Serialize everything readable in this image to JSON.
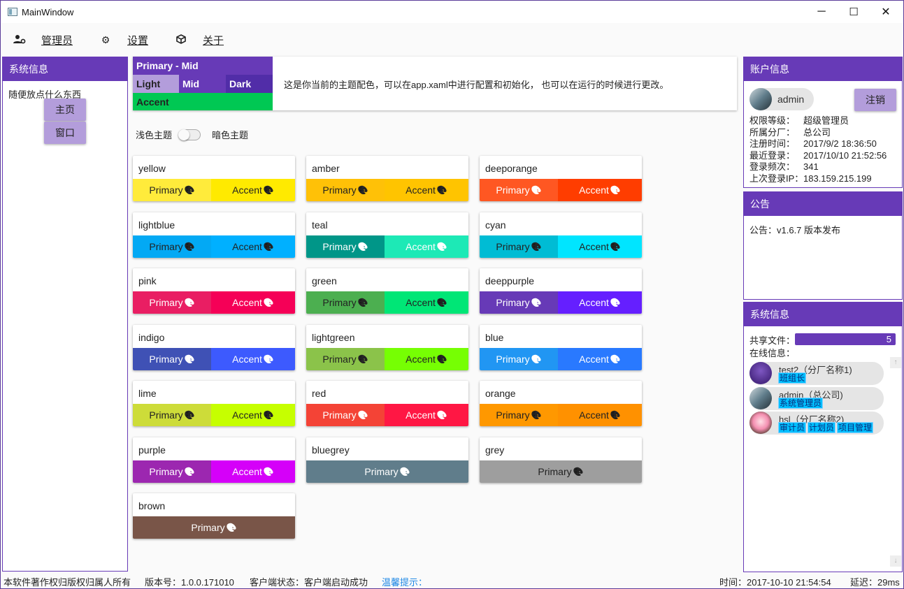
{
  "window": {
    "title": "MainWindow",
    "minimize": "─",
    "maximize": "☐",
    "close": "✕"
  },
  "menu": [
    {
      "label": "管理员",
      "icon": "manage-accounts-icon",
      "glyph": "👥"
    },
    {
      "label": "设置",
      "icon": "gear-icon",
      "glyph": "⚙"
    },
    {
      "label": "关于",
      "icon": "cube-icon",
      "glyph": "⬡"
    }
  ],
  "left_panel": {
    "title": "系统信息",
    "text": "随便放点什么东西",
    "buttons": [
      "主页",
      "窗口"
    ]
  },
  "theme": {
    "primary_mid": "Primary - Mid",
    "light": "Light",
    "mid": "Mid",
    "dark": "Dark",
    "accent": "Accent",
    "description": "这是你当前的主题配色，可以在app.xaml中进行配置和初始化， 也可以在运行的时候进行更改。",
    "colors": {
      "primary": "#673ab7",
      "light": "#b39ddb",
      "mid": "#673ab7",
      "dark": "#512da8",
      "accent": "#00c853"
    }
  },
  "toggle": {
    "light_label": "浅色主题",
    "dark_label": "暗色主题"
  },
  "swatches": [
    {
      "name": "yellow",
      "primary": "Primary",
      "accent": "Accent",
      "pc": "#ffeb3b",
      "ac": "#ffea00",
      "pt": "#222",
      "at": "#222"
    },
    {
      "name": "amber",
      "primary": "Primary",
      "accent": "Accent",
      "pc": "#ffc107",
      "ac": "#ffc400",
      "pt": "#222",
      "at": "#222"
    },
    {
      "name": "deeporange",
      "primary": "Primary",
      "accent": "Accent",
      "pc": "#ff5722",
      "ac": "#ff3d00",
      "pt": "#fff",
      "at": "#fff"
    },
    {
      "name": "lightblue",
      "primary": "Primary",
      "accent": "Accent",
      "pc": "#03a9f4",
      "ac": "#00b0ff",
      "pt": "#222",
      "at": "#222"
    },
    {
      "name": "teal",
      "primary": "Primary",
      "accent": "Accent",
      "pc": "#009688",
      "ac": "#1de9b6",
      "pt": "#fff",
      "at": "#fff"
    },
    {
      "name": "cyan",
      "primary": "Primary",
      "accent": "Accent",
      "pc": "#00bcd4",
      "ac": "#00e5ff",
      "pt": "#222",
      "at": "#222"
    },
    {
      "name": "pink",
      "primary": "Primary",
      "accent": "Accent",
      "pc": "#e91e63",
      "ac": "#f50057",
      "pt": "#fff",
      "at": "#fff"
    },
    {
      "name": "green",
      "primary": "Primary",
      "accent": "Accent",
      "pc": "#4caf50",
      "ac": "#00e676",
      "pt": "#222",
      "at": "#222"
    },
    {
      "name": "deeppurple",
      "primary": "Primary",
      "accent": "Accent",
      "pc": "#673ab7",
      "ac": "#651fff",
      "pt": "#fff",
      "at": "#fff"
    },
    {
      "name": "indigo",
      "primary": "Primary",
      "accent": "Accent",
      "pc": "#3f51b5",
      "ac": "#3d5afe",
      "pt": "#fff",
      "at": "#fff"
    },
    {
      "name": "lightgreen",
      "primary": "Primary",
      "accent": "Accent",
      "pc": "#8bc34a",
      "ac": "#76ff03",
      "pt": "#222",
      "at": "#222"
    },
    {
      "name": "blue",
      "primary": "Primary",
      "accent": "Accent",
      "pc": "#2196f3",
      "ac": "#2979ff",
      "pt": "#fff",
      "at": "#fff"
    },
    {
      "name": "lime",
      "primary": "Primary",
      "accent": "Accent",
      "pc": "#cddc39",
      "ac": "#c6ff00",
      "pt": "#222",
      "at": "#222"
    },
    {
      "name": "red",
      "primary": "Primary",
      "accent": "Accent",
      "pc": "#f44336",
      "ac": "#ff1744",
      "pt": "#fff",
      "at": "#fff"
    },
    {
      "name": "orange",
      "primary": "Primary",
      "accent": "Accent",
      "pc": "#ff9800",
      "ac": "#ff9100",
      "pt": "#222",
      "at": "#222"
    },
    {
      "name": "purple",
      "primary": "Primary",
      "accent": "Accent",
      "pc": "#9c27b0",
      "ac": "#d500f9",
      "pt": "#fff",
      "at": "#fff"
    },
    {
      "name": "bluegrey",
      "primary": "Primary",
      "accent": null,
      "pc": "#607d8b",
      "ac": null,
      "pt": "#fff",
      "at": null
    },
    {
      "name": "grey",
      "primary": "Primary",
      "accent": null,
      "pc": "#9e9e9e",
      "ac": null,
      "pt": "#222",
      "at": null
    },
    {
      "name": "brown",
      "primary": "Primary",
      "accent": null,
      "pc": "#795548",
      "ac": null,
      "pt": "#fff",
      "at": null
    }
  ],
  "account": {
    "title": "账户信息",
    "username": "admin",
    "logout": "注销",
    "rows": [
      {
        "key": "权限等级：",
        "value": "超级管理员"
      },
      {
        "key": "所属分厂：",
        "value": "总公司"
      },
      {
        "key": "注册时间：",
        "value": "2017/9/2 18:36:50"
      },
      {
        "key": "最近登录：",
        "value": "2017/10/10 21:52:56"
      },
      {
        "key": "登录频次：",
        "value": "341"
      },
      {
        "key": "上次登录IP：",
        "value": "183.159.215.199"
      }
    ]
  },
  "notice": {
    "title": "公告",
    "text": "公告：v1.6.7 版本发布"
  },
  "sysinfo": {
    "title": "系统信息",
    "shared_label": "共享文件：",
    "shared_count": "5",
    "online_label": "在线信息：",
    "users": [
      {
        "name": "test2（分厂名称1)",
        "tags": [
          "班组长"
        ]
      },
      {
        "name": "admin（总公司)",
        "tags": [
          "系统管理员"
        ]
      },
      {
        "name": "hsl（分厂名称2)",
        "tags": [
          "审计员",
          "计划员",
          "项目管理"
        ]
      }
    ]
  },
  "status": {
    "copyright": "本软件著作权归版权归属人所有",
    "version": "版本号：1.0.0.171010",
    "client": "客户端状态：客户端启动成功",
    "tip": "温馨提示：",
    "time": "时间：2017-10-10 21:54:54",
    "latency": "延迟：29ms"
  }
}
